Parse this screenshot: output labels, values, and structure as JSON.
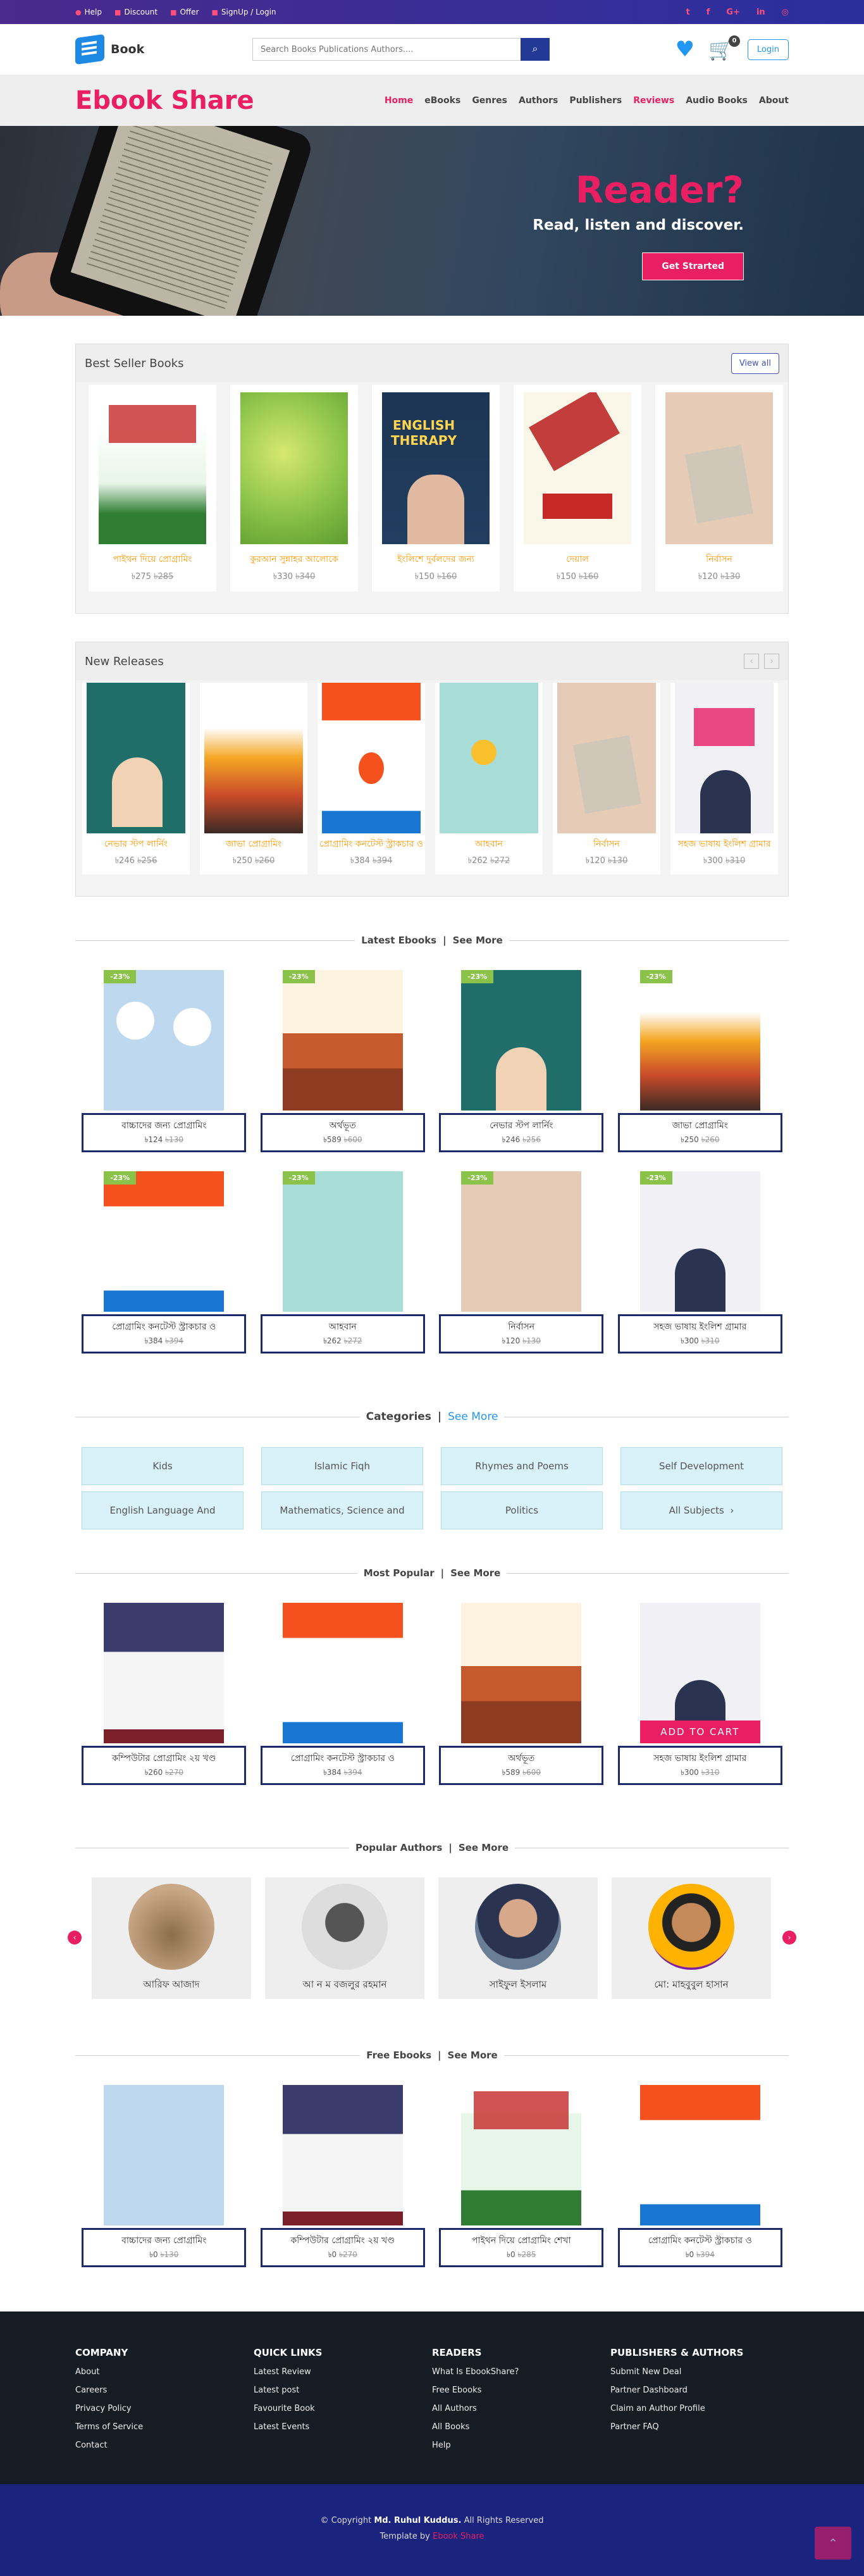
{
  "topbar": {
    "help": "Help",
    "discount": "Discount",
    "offer": "Offer",
    "signup": "SignUp / Login"
  },
  "header": {
    "logo": "Book",
    "search_placeholder": "Search Books Publications Authors....",
    "cart_count": "0",
    "login": "Login"
  },
  "nav": {
    "brand": "Ebook Share",
    "items": [
      "Home",
      "eBooks",
      "Genres",
      "Authors",
      "Publishers",
      "Reviews",
      "Audio Books",
      "About"
    ]
  },
  "hero": {
    "title": "Reader?",
    "subtitle": "Read, listen and discover.",
    "cta": "Get Strarted"
  },
  "best_sellers": {
    "title": "Best Seller Books",
    "view_all": "View all",
    "items": [
      {
        "title": "পাইথন দিয়ে প্রোগ্রামিং",
        "price": "৳275",
        "old": "৳285"
      },
      {
        "title": "কুরআন সুন্নাহর আলোকে",
        "price": "৳330",
        "old": "৳340"
      },
      {
        "title": "ইংলিশে দুর্বলদের জন্য",
        "price": "৳150",
        "old": "৳160"
      },
      {
        "title": "দেয়াল",
        "price": "৳150",
        "old": "৳160"
      },
      {
        "title": "নির্বাসন",
        "price": "৳120",
        "old": "৳130"
      }
    ]
  },
  "new_releases": {
    "title": "New Releases",
    "items": [
      {
        "title": "নেভার স্টপ লার্নিং",
        "price": "৳246",
        "old": "৳256"
      },
      {
        "title": "জাভা প্রোগ্রামিং",
        "price": "৳250",
        "old": "৳260"
      },
      {
        "title": "প্রোগ্রামিং কনটেস্ট স্ট্রাকচার ও",
        "price": "৳384",
        "old": "৳394"
      },
      {
        "title": "আহবান",
        "price": "৳262",
        "old": "৳272"
      },
      {
        "title": "নির্বাসন",
        "price": "৳120",
        "old": "৳130"
      },
      {
        "title": "সহজ ভাষায় ইংলিশ গ্রামার",
        "price": "৳300",
        "old": "৳310"
      }
    ]
  },
  "latest": {
    "heading": "Latest Ebooks",
    "see_more": "See More",
    "badge": "-23%",
    "items": [
      {
        "title": "বাচ্চাদের জন্য প্রোগ্রামিং",
        "price": "৳124",
        "old": "৳130"
      },
      {
        "title": "অর্থভূত",
        "price": "৳589",
        "old": "৳600"
      },
      {
        "title": "নেভার স্টপ লার্নিং",
        "price": "৳246",
        "old": "৳256"
      },
      {
        "title": "জাভা প্রোগ্রামিং",
        "price": "৳250",
        "old": "৳260"
      },
      {
        "title": "প্রোগ্রামিং কনটেস্ট স্ট্রাকচার ও",
        "price": "৳384",
        "old": "৳394"
      },
      {
        "title": "আহবান",
        "price": "৳262",
        "old": "৳272"
      },
      {
        "title": "নির্বাসন",
        "price": "৳120",
        "old": "৳130"
      },
      {
        "title": "সহজ ভাষায় ইংলিশ গ্রামার",
        "price": "৳300",
        "old": "৳310"
      }
    ]
  },
  "categories": {
    "heading": "Categories",
    "see_more": "See More",
    "items": [
      "Kids",
      "Islamic Fiqh",
      "Rhymes and Poems",
      "Self Development",
      "English Language And",
      "Mathematics, Science and",
      "Politics",
      "All Subjects"
    ]
  },
  "popular": {
    "heading": "Most Popular",
    "see_more": "See More",
    "add_to_cart": "ADD TO CART",
    "items": [
      {
        "title": "কম্পিউটার প্রোগ্রামিং ২য় খণ্ড",
        "price": "৳260",
        "old": "৳270"
      },
      {
        "title": "প্রোগ্রামিং কনটেস্ট স্ট্রাকচার ও",
        "price": "৳384",
        "old": "৳394"
      },
      {
        "title": "অর্থভূত",
        "price": "৳589",
        "old": "৳600"
      },
      {
        "title": "সহজ ভাষায় ইংলিশ গ্রামার",
        "price": "৳300",
        "old": "৳310"
      }
    ]
  },
  "authors": {
    "heading": "Popular Authors",
    "see_more": "See More",
    "items": [
      {
        "name": "আরিফ আজাদ"
      },
      {
        "name": "আ ন ম বজলুর রহমান"
      },
      {
        "name": "সাইফুল ইসলাম"
      },
      {
        "name": "মো: মাহবুবুল হাসান"
      }
    ]
  },
  "free": {
    "heading": "Free Ebooks",
    "see_more": "See More",
    "items": [
      {
        "title": "বাচ্চাদের জন্য প্রোগ্রামিং",
        "price": "৳0",
        "old": "৳130"
      },
      {
        "title": "কম্পিউটার প্রোগ্রামিং ২য় খণ্ড",
        "price": "৳0",
        "old": "৳270"
      },
      {
        "title": "পাইথন দিয়ে প্রোগ্রামিং শেখা",
        "price": "৳0",
        "old": "৳285"
      },
      {
        "title": "প্রোগ্রামিং কনটেস্ট স্ট্রাকচার ও",
        "price": "৳0",
        "old": "৳394"
      }
    ]
  },
  "footer": {
    "cols": [
      {
        "title": "Company",
        "links": [
          "About",
          "Careers",
          "Privacy Policy",
          "Terms of Service",
          "Contact"
        ]
      },
      {
        "title": "Quick Links",
        "links": [
          "Latest Review",
          "Latest post",
          "Favourite Book",
          "Latest Events"
        ]
      },
      {
        "title": "Readers",
        "links": [
          "What Is EbookShare?",
          "Free Ebooks",
          "All Authors",
          "All Books",
          "Help"
        ]
      },
      {
        "title": "Publishers & Authors",
        "links": [
          "Submit New Deal",
          "Partner Dashboard",
          "Claim an Author Profile",
          "Partner FAQ"
        ]
      }
    ],
    "copyright": "© Copyright",
    "owner": "Md. Ruhul Kuddus.",
    "rights": "All Rights Reserved",
    "template": "Template by",
    "template_name": "Ebook Share"
  },
  "colors": {
    "accent": "#e91e63",
    "brand_blue": "#1a237e",
    "price_orange": "#ff9800"
  }
}
